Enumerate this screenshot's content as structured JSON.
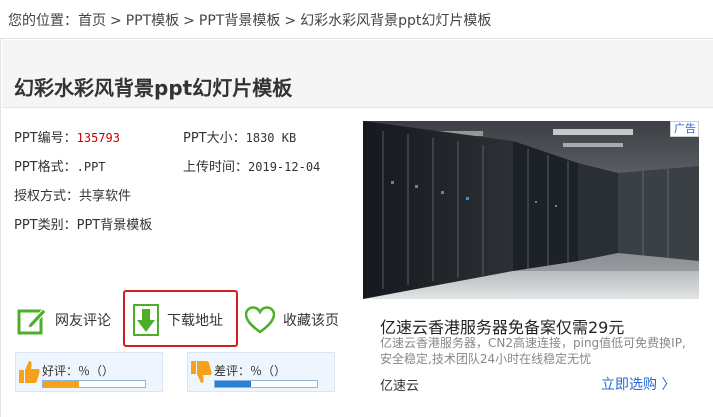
{
  "breadcrumb": {
    "prefix": "您的位置：",
    "items": [
      "首页",
      "PPT模板",
      "PPT背景模板",
      "幻彩水彩风背景ppt幻灯片模板"
    ],
    "separator": ">"
  },
  "title": "幻彩水彩风背景ppt幻灯片模板",
  "info": {
    "id_label": "PPT编号：",
    "id_value": "135793",
    "size_label": "PPT大小：",
    "size_value": "1830 KB",
    "format_label": "PPT格式：",
    "format_value": ".PPT",
    "upload_label": "上传时间：",
    "upload_value": "2019-12-04",
    "license_label": "授权方式：",
    "license_value": "共享软件",
    "category_label": "PPT类别：",
    "category_value": "PPT背景模板"
  },
  "actions": {
    "comment": "网友评论",
    "download": "下载地址",
    "favorite": "收藏该页"
  },
  "rating": {
    "good_label": "好评：％（）",
    "good_fraction": 0.35,
    "bad_label": "差评：％（）",
    "bad_fraction": 0.35
  },
  "ad": {
    "tag": "广告",
    "title": "亿速云香港服务器免备案仅需29元",
    "desc": "亿速云香港服务器，CN2高速连接，ping值低可免费换IP,安全稳定,技术团队24小时在线稳定无忧",
    "brand": "亿速云",
    "cta": "立即选购 〉"
  },
  "colors": {
    "accent_red": "#d51d1d",
    "link_blue": "#2469d6",
    "icon_green": "#4caf2a",
    "bar_orange": "#f5a21a",
    "bar_blue": "#2a7fd4"
  }
}
